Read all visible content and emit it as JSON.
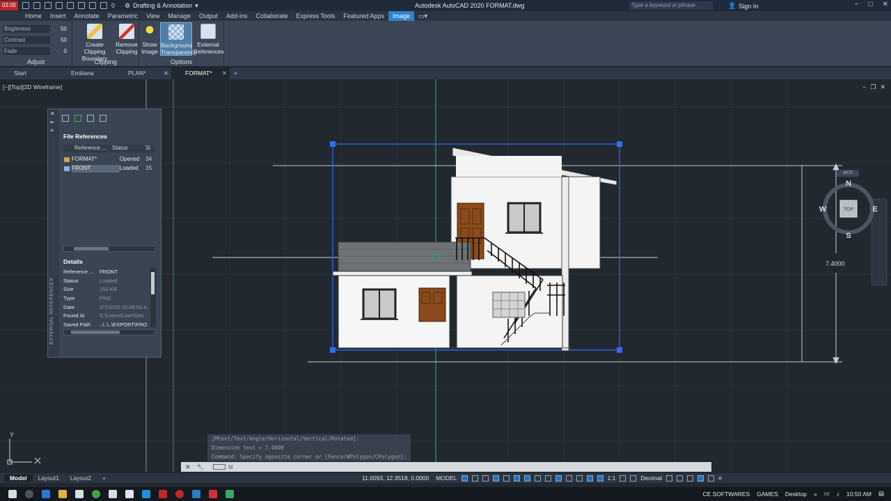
{
  "titlebar": {
    "workspace": "Drafting & Annotation",
    "app_title": "Autodesk AutoCAD 2020    FORMAT.dwg",
    "search_placeholder": "Type a keyword or phrase",
    "sign_in": "Sign In",
    "counter": "0",
    "logo_time": "03:00"
  },
  "ribbon_tabs": [
    "Home",
    "Insert",
    "Annotate",
    "Parametric",
    "View",
    "Manage",
    "Output",
    "Add-ins",
    "Collaborate",
    "Express Tools",
    "Featured Apps",
    "Image"
  ],
  "active_tab": "Image",
  "ribbon": {
    "adjust": {
      "title": "Adjust",
      "brightness_label": "Brightness",
      "brightness": "50",
      "contrast_label": "Contrast",
      "contrast": "50",
      "fade_label": "Fade",
      "fade": "0"
    },
    "clipping": {
      "title": "Clipping",
      "create_line1": "Create Clipping",
      "create_line2": "Boundary",
      "remove_line1": "Remove",
      "remove_line2": "Clipping"
    },
    "options": {
      "title": "Options",
      "show_line1": "Show",
      "show_line2": "Image",
      "bg_line1": "Background",
      "bg_line2": "Transparency",
      "ext_line1": "External",
      "ext_line2": "References"
    }
  },
  "file_tabs": [
    {
      "label": "Start",
      "closable": false
    },
    {
      "label": "Emiliana Diana*",
      "closable": true
    },
    {
      "label": "PLAN*",
      "closable": true
    },
    {
      "label": "FORMAT*",
      "closable": true
    }
  ],
  "viewport_label": "[−][Top][2D Wireframe]",
  "xref": {
    "vertical_title": "EXTERNAL REFERENCES",
    "file_references": "File References",
    "col_reference": "Reference ...",
    "col_status": "Status",
    "col_size": "Si",
    "rows": [
      {
        "name": "FORMAT*",
        "status": "Opened",
        "size": "34"
      },
      {
        "name": "FRONT",
        "status": "Loaded",
        "size": "15"
      }
    ],
    "details_title": "Details",
    "details": [
      {
        "k": "Reference ...",
        "v": "FRONT",
        "white": true
      },
      {
        "k": "Status",
        "v": "Loaded",
        "white": false
      },
      {
        "k": "Size",
        "v": "152 KB",
        "white": false
      },
      {
        "k": "Type",
        "v": "PNG",
        "white": false
      },
      {
        "k": "Date",
        "v": "1/7/2020 10:48:52 A",
        "white": false
      },
      {
        "k": "Found At",
        "v": "C:\\Users\\User\\Des",
        "white": false
      },
      {
        "k": "Saved Path",
        "v": "..\\..\\..\\EXPORT\\FRO",
        "white": true
      }
    ]
  },
  "dimension_value": "7.4000",
  "viewcube": {
    "n": "N",
    "s": "S",
    "e": "E",
    "w": "W",
    "top": "TOP",
    "wcs": "WCS"
  },
  "command": {
    "line1": "[Mtext/Text/Angle/Horizontal/Vertical/Rotated]:",
    "line2": "Dimension text = 7.4000",
    "line3": "Command: Specify opposite corner or [Fence/WPolygon/CPolygon]:",
    "prompt": "M"
  },
  "layout_tabs": [
    "Model",
    "Layout1",
    "Layout2"
  ],
  "status": {
    "coords": "11.0093, 12.3518, 0.0000",
    "model": "MODEL",
    "scale": "1:1",
    "units": "Decimal"
  },
  "taskbar": {
    "tray1": "CE SOFTWARES",
    "tray2": "GAMES",
    "tray3": "Desktop",
    "time": "10:50 AM"
  },
  "colors": {
    "accent": "#2f82c9",
    "viewport_bg": "#212830",
    "grip": "#2f6ff0",
    "door": "#8b4a1c"
  }
}
